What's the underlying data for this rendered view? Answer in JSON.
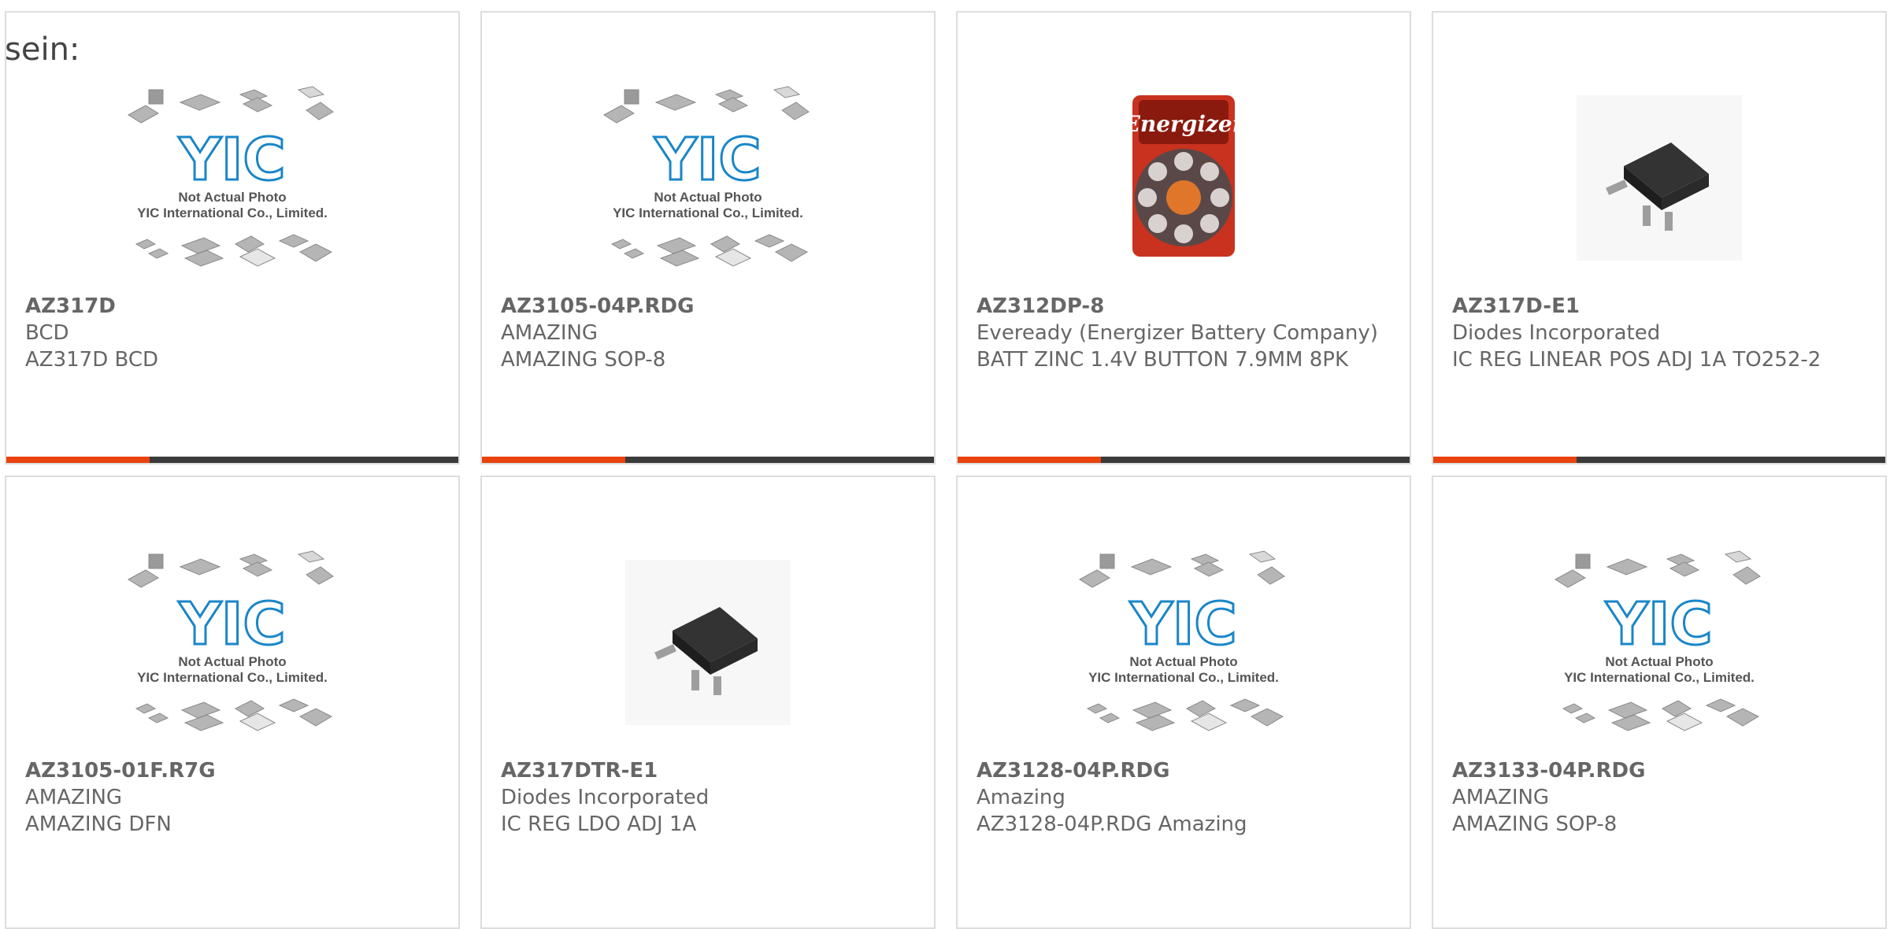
{
  "heading": "sein:",
  "colors": {
    "accent": "#e8430f",
    "bar_dark": "#3a3a3a",
    "yic_blue": "#1a86c8"
  },
  "placeholder": {
    "line1": "Not Actual Photo",
    "line2": "YIC International Co., Limited.",
    "logo": "YIC"
  },
  "products": [
    {
      "part": "AZ317D",
      "manufacturer": "BCD",
      "description": "AZ317D BCD",
      "image": "yic-placeholder"
    },
    {
      "part": "AZ3105-04P.RDG",
      "manufacturer": "AMAZING",
      "description": "AMAZING SOP-8",
      "image": "yic-placeholder"
    },
    {
      "part": "AZ312DP-8",
      "manufacturer": "Eveready (Energizer Battery Company)",
      "description": "BATT ZINC 1.4V BUTTON 7.9MM 8PK",
      "image": "energizer-battery-pack",
      "brand_text": "Energizer"
    },
    {
      "part": "AZ317D-E1",
      "manufacturer": "Diodes Incorporated",
      "description": "IC REG LINEAR POS ADJ 1A TO252-2",
      "image": "to252-chip"
    },
    {
      "part": "AZ3105-01F.R7G",
      "manufacturer": "AMAZING",
      "description": "AMAZING DFN",
      "image": "yic-placeholder"
    },
    {
      "part": "AZ317DTR-E1",
      "manufacturer": "Diodes Incorporated",
      "description": "IC REG LDO ADJ 1A",
      "image": "to252-chip"
    },
    {
      "part": "AZ3128-04P.RDG",
      "manufacturer": "Amazing",
      "description": "AZ3128-04P.RDG Amazing",
      "image": "yic-placeholder"
    },
    {
      "part": "AZ3133-04P.RDG",
      "manufacturer": "AMAZING",
      "description": "AMAZING SOP-8",
      "image": "yic-placeholder"
    }
  ]
}
